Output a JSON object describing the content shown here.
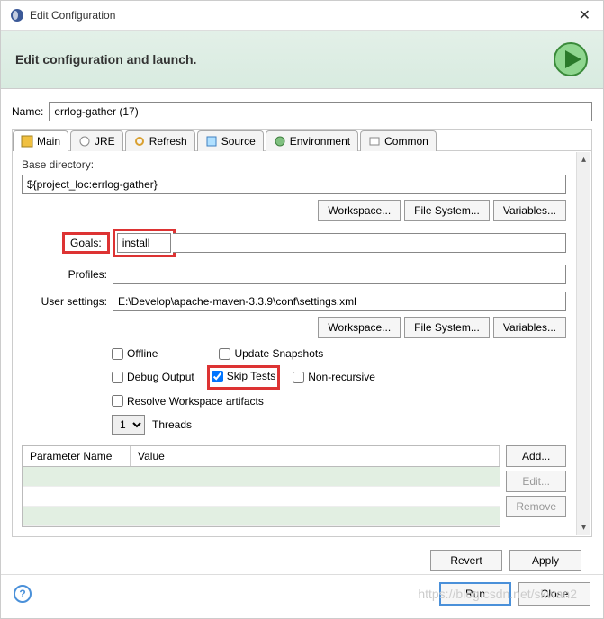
{
  "title": "Edit Configuration",
  "subtitle": "Edit configuration and launch.",
  "name_label": "Name:",
  "name_value": "errlog-gather (17)",
  "tabs": [
    {
      "label": "Main"
    },
    {
      "label": "JRE"
    },
    {
      "label": "Refresh"
    },
    {
      "label": "Source"
    },
    {
      "label": "Environment"
    },
    {
      "label": "Common"
    }
  ],
  "base_dir_label": "Base directory:",
  "base_dir_value": "${project_loc:errlog-gather}",
  "workspace_btn": "Workspace...",
  "filesystem_btn": "File System...",
  "variables_btn": "Variables...",
  "goals_label": "Goals:",
  "goals_value": "install",
  "profiles_label": "Profiles:",
  "profiles_value": "",
  "user_settings_label": "User settings:",
  "user_settings_value": "E:\\Develop\\apache-maven-3.3.9\\conf\\settings.xml",
  "checkboxes": {
    "offline": "Offline",
    "update": "Update Snapshots",
    "debug": "Debug Output",
    "skip": "Skip Tests",
    "nonrec": "Non-recursive",
    "resolve": "Resolve Workspace artifacts"
  },
  "threads_value": "1",
  "threads_label": "Threads",
  "table": {
    "col1": "Parameter Name",
    "col2": "Value",
    "add": "Add...",
    "edit": "Edit...",
    "remove": "Remove"
  },
  "revert": "Revert",
  "apply": "Apply",
  "run": "Run",
  "close": "Close",
  "watermark": "https://blog.csdn.net/skwan2"
}
